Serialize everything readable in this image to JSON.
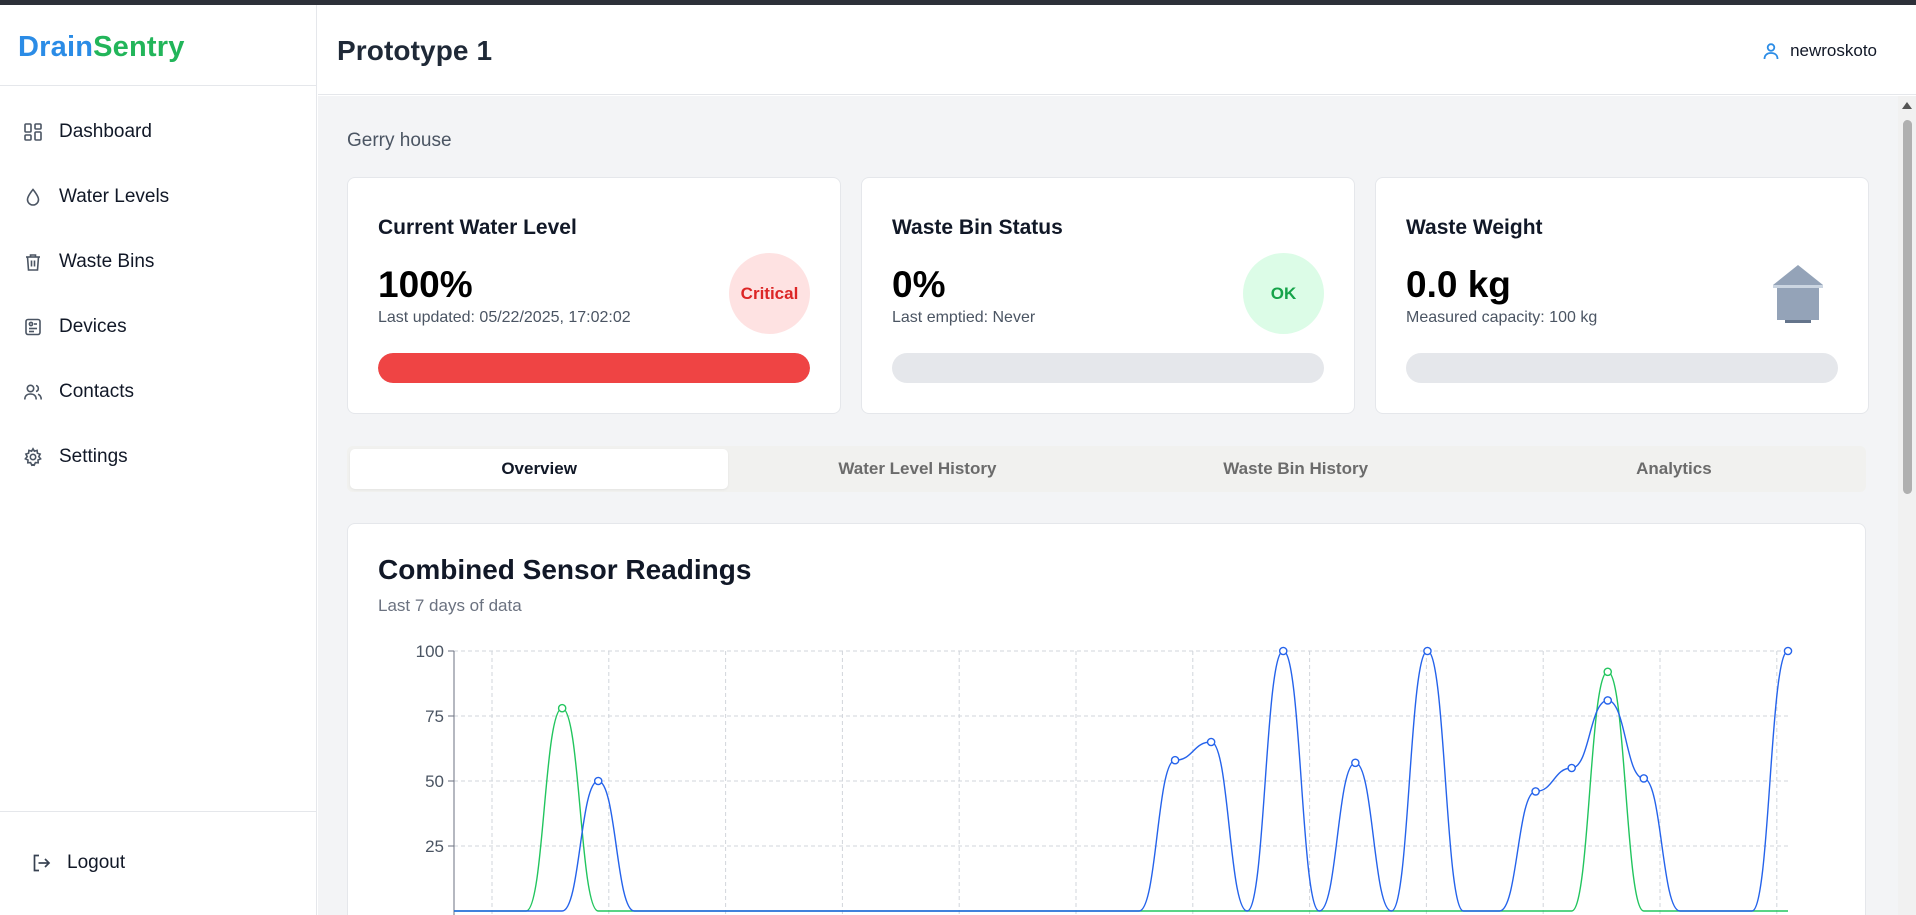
{
  "brand": {
    "part1": "Drain",
    "part2": "Sentry"
  },
  "sidebar": {
    "items": [
      {
        "label": "Dashboard",
        "icon": "dashboard-icon"
      },
      {
        "label": "Water Levels",
        "icon": "droplet-icon"
      },
      {
        "label": "Waste Bins",
        "icon": "trash-icon"
      },
      {
        "label": "Devices",
        "icon": "device-icon"
      },
      {
        "label": "Contacts",
        "icon": "users-icon"
      },
      {
        "label": "Settings",
        "icon": "gear-icon"
      }
    ],
    "logout": "Logout"
  },
  "header": {
    "title": "Prototype 1",
    "username": "newroskoto"
  },
  "location": "Gerry house",
  "cards": {
    "water": {
      "title": "Current Water Level",
      "value": "100%",
      "sub": "Last updated: 05/22/2025, 17:02:02",
      "badge": "Critical",
      "progress": 100,
      "fill_color": "#ef4444"
    },
    "bin": {
      "title": "Waste Bin Status",
      "value": "0%",
      "sub": "Last emptied: Never",
      "badge": "OK",
      "progress": 0
    },
    "weight": {
      "title": "Waste Weight",
      "value": "0.0 kg",
      "sub": "Measured capacity: 100 kg",
      "icon": "house-icon",
      "progress": 0
    }
  },
  "tabs": [
    "Overview",
    "Water Level History",
    "Waste Bin History",
    "Analytics"
  ],
  "active_tab": "Overview",
  "chart": {
    "title": "Combined Sensor Readings",
    "subtitle": "Last 7 days of data"
  },
  "chart_data": {
    "type": "line",
    "yticks": [
      "100",
      "75",
      "50",
      "25"
    ],
    "ylim": [
      0,
      100
    ],
    "grid": true,
    "series": [
      {
        "color": "#2563eb",
        "values": [
          0,
          0,
          0,
          0,
          50,
          0,
          0,
          0,
          0,
          0,
          0,
          0,
          0,
          0,
          0,
          0,
          0,
          0,
          0,
          0,
          58,
          65,
          0,
          100,
          0,
          57,
          0,
          100,
          0,
          0,
          46,
          55,
          81,
          51,
          0,
          0,
          0,
          100
        ]
      },
      {
        "color": "#22c55e",
        "values": [
          0,
          0,
          0,
          78,
          0,
          0,
          0,
          0,
          0,
          0,
          0,
          0,
          0,
          0,
          0,
          0,
          0,
          0,
          0,
          0,
          0,
          0,
          0,
          0,
          0,
          0,
          0,
          0,
          0,
          0,
          0,
          0,
          92,
          0,
          0,
          0,
          0,
          0
        ]
      }
    ]
  }
}
